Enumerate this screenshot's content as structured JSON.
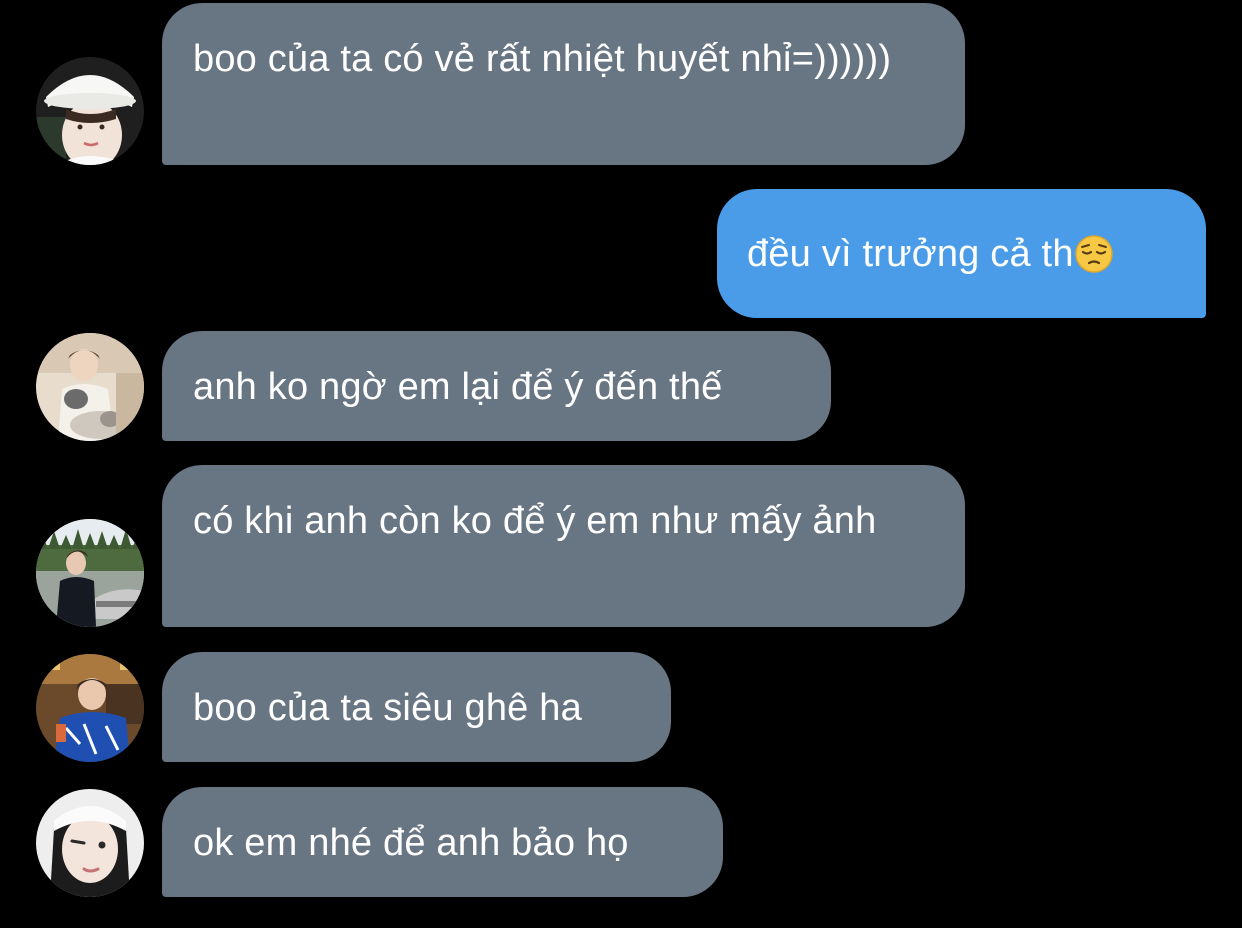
{
  "messages": [
    {
      "direction": "incoming",
      "text": "boo của ta có vẻ rất nhiệt huyết nhỉ=))))))",
      "avatar": "avatar-white-bucket-hat"
    },
    {
      "direction": "outgoing",
      "text": "đều vì trưởng cả th",
      "emoji": "pensive-face"
    },
    {
      "direction": "incoming",
      "text": "anh ko ngờ em lại để ý đến thế",
      "avatar": "avatar-with-cat"
    },
    {
      "direction": "incoming",
      "text": "có khi anh còn ko để ý em như mấy ảnh",
      "avatar": "avatar-outdoor-car"
    },
    {
      "direction": "incoming",
      "text": "boo của ta siêu ghê ha",
      "avatar": "avatar-cafe-blue-shirt"
    },
    {
      "direction": "incoming",
      "text": "ok em nhé để anh bảo họ",
      "avatar": "avatar-white-headband"
    }
  ],
  "colors": {
    "background": "#000000",
    "incoming_bubble": "#687583",
    "outgoing_bubble": "#4a9ce8",
    "text": "#ffffff"
  }
}
